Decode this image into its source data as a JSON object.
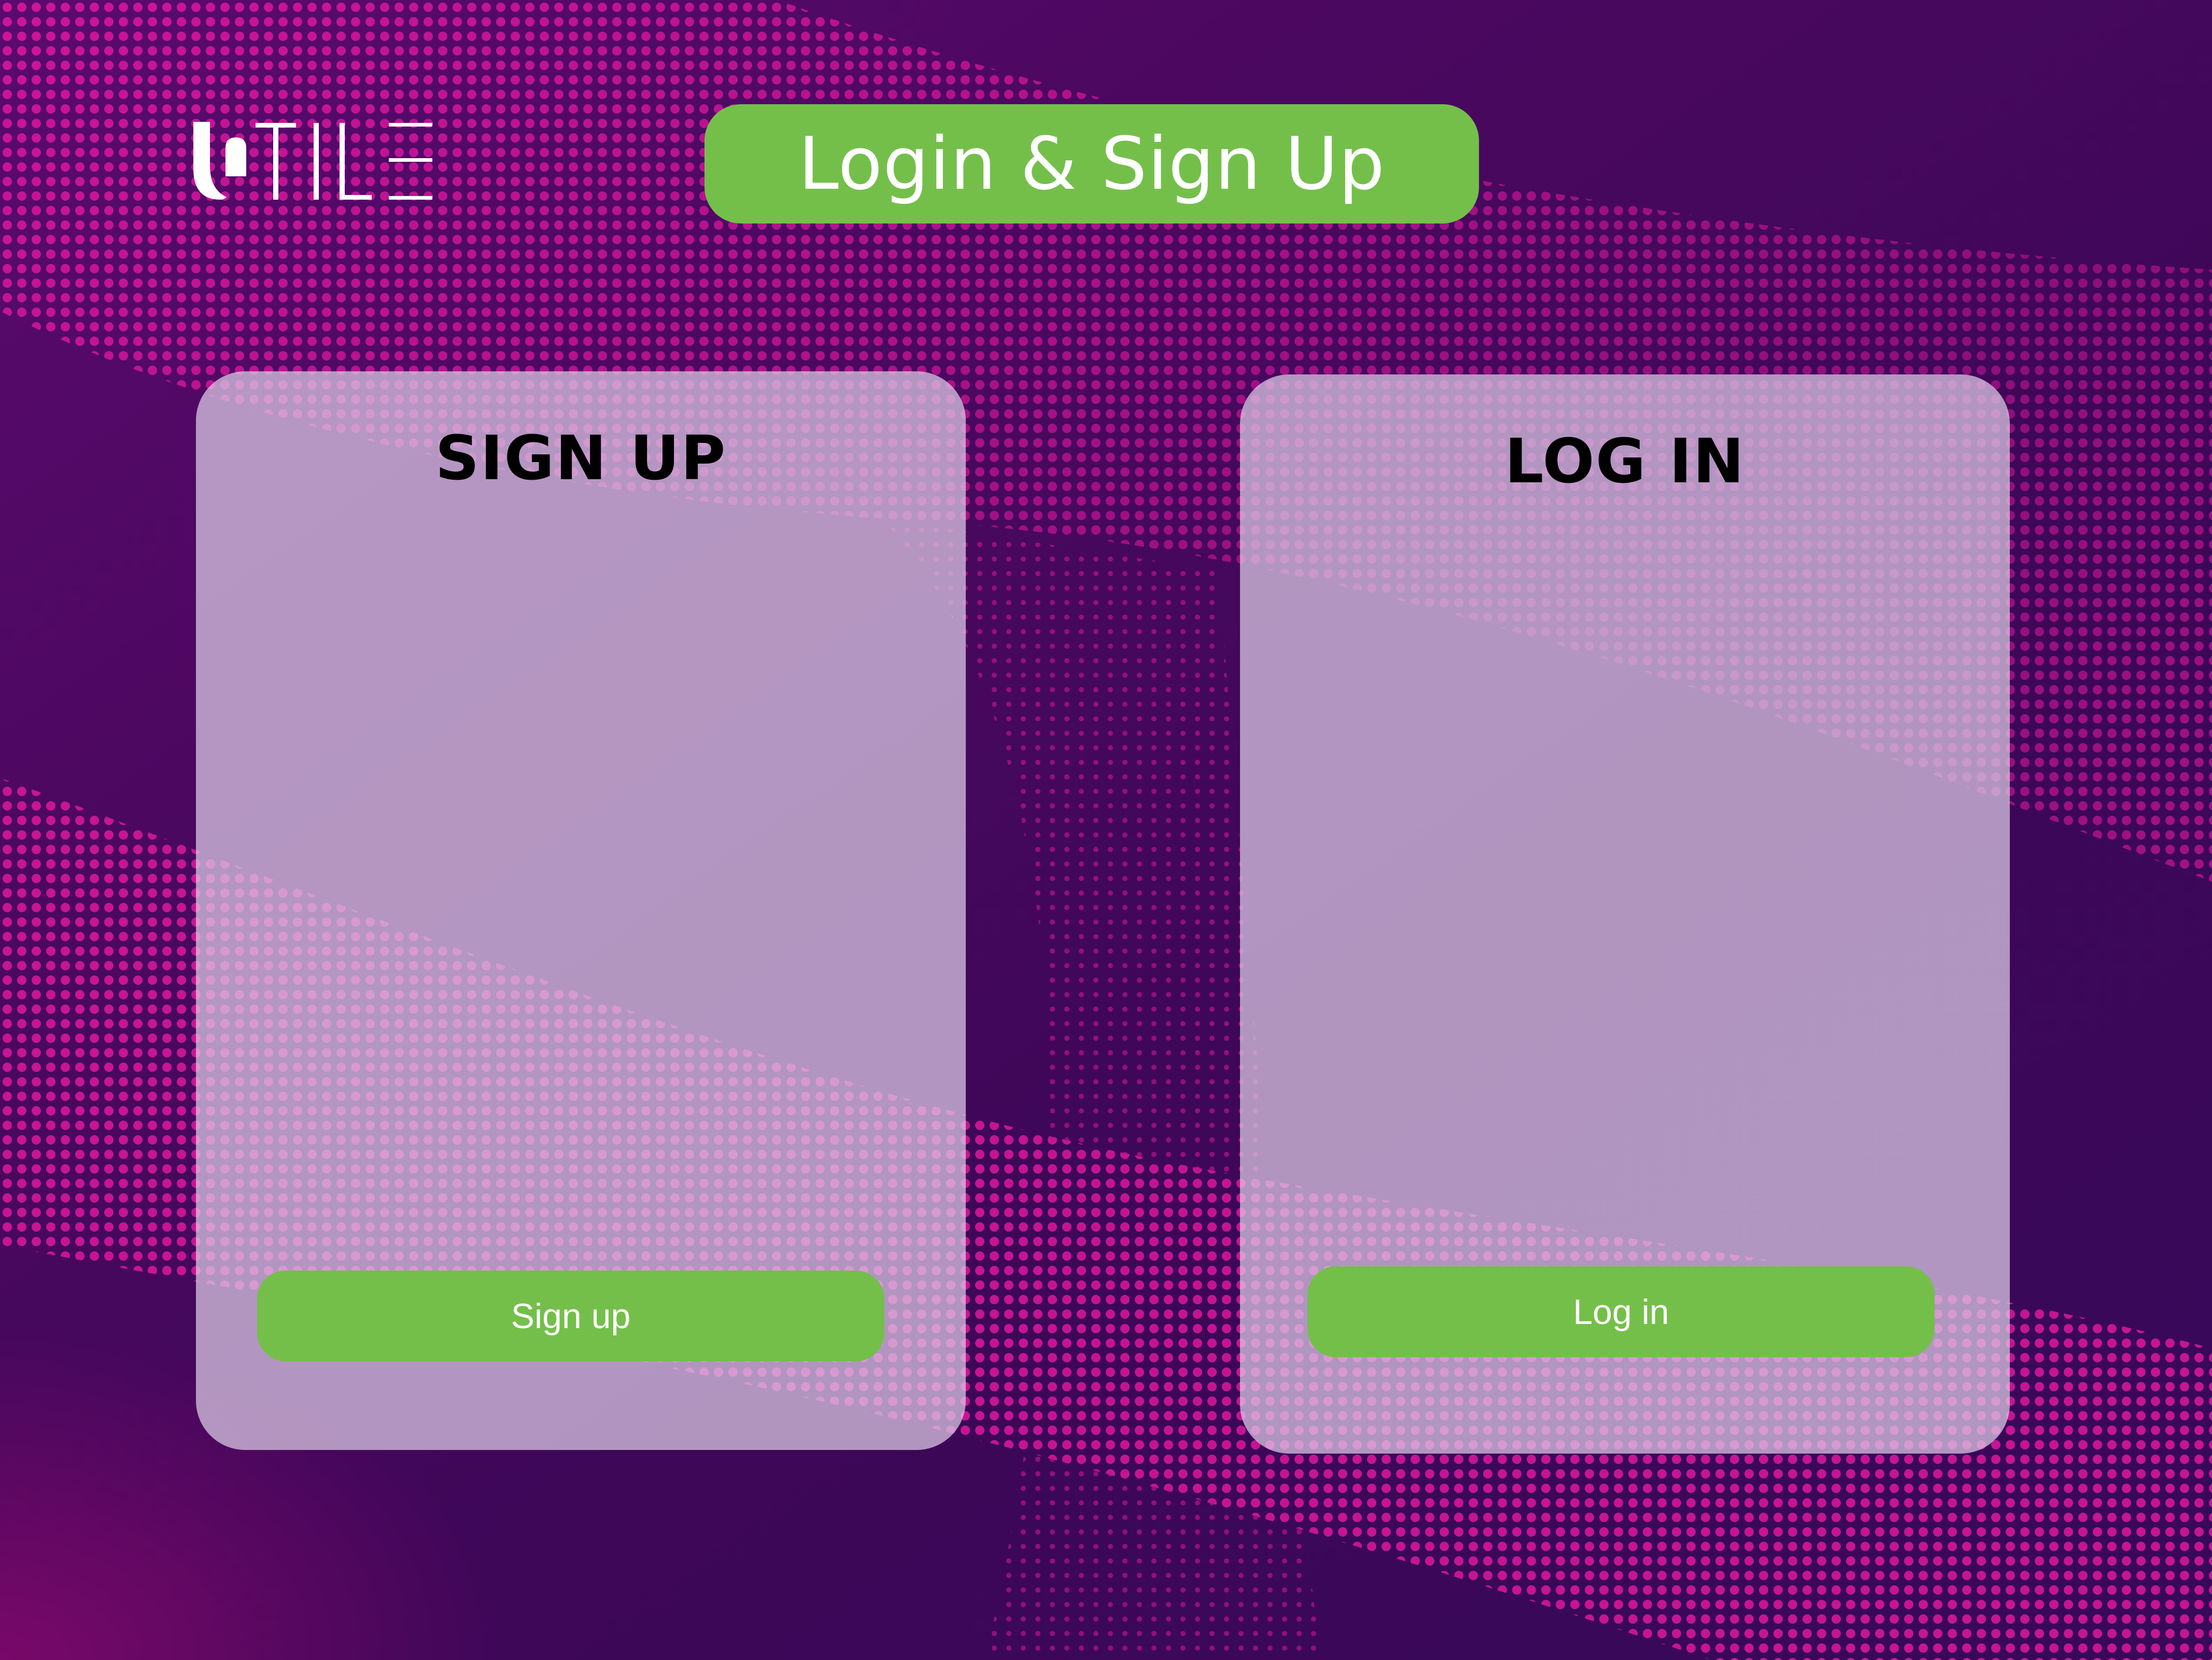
{
  "logo": {
    "text": "UTILE",
    "icon": "utile-logo-icon"
  },
  "header": {
    "title": "Login & Sign Up"
  },
  "signup_card": {
    "title": "SIGN UP",
    "button_label": "Sign up"
  },
  "login_card": {
    "title": "LOG IN",
    "button_label": "Log in"
  },
  "colors": {
    "accent_green": "#74bf4a",
    "background_purple": "#4b0860",
    "dot_magenta": "#d4169b",
    "card_fill": "#dccbe6",
    "text_white": "#ffffff",
    "text_black": "#000000"
  }
}
